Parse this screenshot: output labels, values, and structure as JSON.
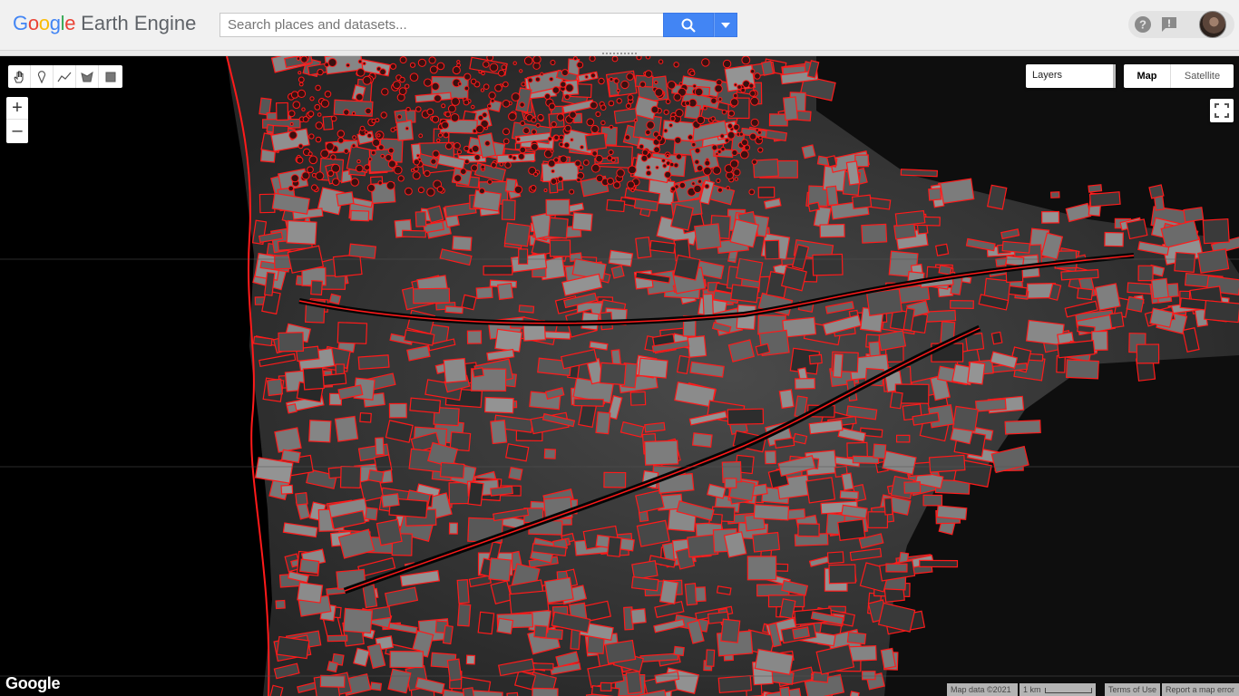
{
  "app": {
    "logo_google": "Google",
    "logo_product": "Earth Engine"
  },
  "search": {
    "placeholder": "Search places and datasets..."
  },
  "header_icons": [
    "search-icon",
    "chevron-down-icon",
    "help-icon",
    "feedback-icon",
    "avatar"
  ],
  "map": {
    "draw_tools": [
      "pan-hand-icon",
      "add-marker-icon",
      "draw-line-icon",
      "draw-shape-icon",
      "draw-rectangle-icon"
    ],
    "zoom_in": "+",
    "zoom_out": "–",
    "layers_label": "Layers",
    "map_type": {
      "map_label": "Map",
      "satellite_label": "Satellite",
      "selected": "Map"
    },
    "google_watermark": "Google",
    "footer": {
      "map_data": "Map data ©2021",
      "scale": "1 km",
      "terms": "Terms of Use",
      "report": "Report a map error"
    }
  },
  "colors": {
    "outline": "#ff1a1a",
    "accent": "#4285f4"
  }
}
